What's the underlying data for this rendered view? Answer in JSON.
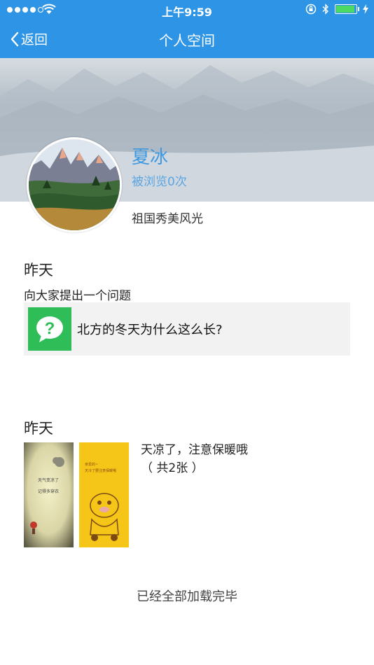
{
  "status_bar": {
    "time": "上午9:59"
  },
  "nav": {
    "back_label": "返回",
    "title": "个人空间"
  },
  "profile": {
    "name": "夏冰",
    "view_count": "被浏览0次",
    "signature": "祖国秀美风光"
  },
  "feed": [
    {
      "date": "昨天",
      "text": "向大家提出一个问题",
      "question_icon": "question-bubble-icon",
      "question": "北方的冬天为什么这么长?"
    },
    {
      "date": "昨天",
      "caption": "天凉了，注意保暖哦",
      "photo_count": "（ 共2张 ）",
      "photos": [
        {
          "thumb_text": "天气变凉了 记得多穿衣"
        },
        {
          "thumb_text": "亲爱的~ 天冷了要注意保暖哦"
        }
      ]
    }
  ],
  "footer": "已经全部加载完毕",
  "colors": {
    "nav_bg": "#2e95e6",
    "accent_blue": "#3d98e0",
    "question_green": "#2ebd57"
  }
}
